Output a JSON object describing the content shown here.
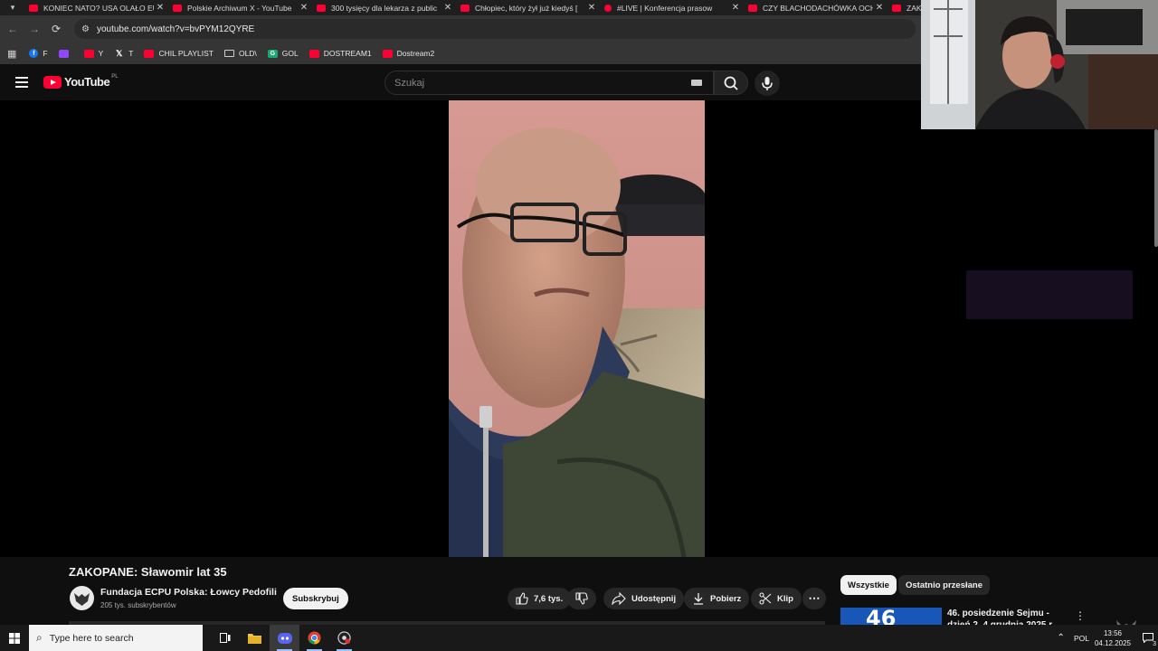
{
  "browser": {
    "tabs": [
      {
        "title": "KONIEC NATO? USA OLAŁO EU",
        "icon": "youtube-icon"
      },
      {
        "title": "Polskie Archiwum X - YouTube",
        "icon": "youtube-icon"
      },
      {
        "title": "300 tysięcy dla lekarza z public",
        "icon": "youtube-icon"
      },
      {
        "title": "Chłopiec, który żył już kiedyś [",
        "icon": "youtube-icon"
      },
      {
        "title": "#LIVE | Konferencja prasow",
        "icon": "live-icon"
      },
      {
        "title": "CZY BLACHODACHÓWKA OCH",
        "icon": "youtube-icon"
      },
      {
        "title": "ZAKO",
        "icon": "youtube-icon"
      }
    ],
    "url": "youtube.com/watch?v=bvPYM12QYRE",
    "bookmarks": [
      {
        "label": "F",
        "icon": "facebook"
      },
      {
        "label": "",
        "icon": "twitch"
      },
      {
        "label": "Y",
        "icon": "youtube"
      },
      {
        "label": "T",
        "icon": "x"
      },
      {
        "label": "CHIL PLAYLIST",
        "icon": "youtube"
      },
      {
        "label": "OLD\\",
        "icon": "folder"
      },
      {
        "label": "GOL",
        "icon": "gol"
      },
      {
        "label": "DOSTREAM1",
        "icon": "youtube"
      },
      {
        "label": "Dostream2",
        "icon": "youtube"
      }
    ]
  },
  "youtube": {
    "logo_text": "YouTube",
    "country_code": "PL",
    "search_placeholder": "Szukaj",
    "video": {
      "title": "ZAKOPANE: Sławomir lat 35",
      "channel": "Fundacja ECPU Polska: Łowcy Pedofili",
      "subscribers": "205 tys. subskrybentów",
      "subscribe_label": "Subskrybuj",
      "likes": "7,6 tys.",
      "share_label": "Udostępnij",
      "download_label": "Pobierz",
      "clip_label": "Klip"
    },
    "chips": [
      "Wszystkie",
      "Ostatnio przesłane"
    ],
    "recommended": {
      "thumb_text": "46",
      "title": "46. posiedzenie Sejmu - dzień 2, 4 grudnia 2025 r."
    }
  },
  "taskbar": {
    "search_placeholder": "Type here to search",
    "lang": "POL",
    "time": "13:56",
    "date": "04.12.2025",
    "notifications": "3"
  },
  "colors": {
    "youtube_red": "#ff0033",
    "background": "#0f0f0f",
    "chip_active": "#f1f1f1"
  }
}
